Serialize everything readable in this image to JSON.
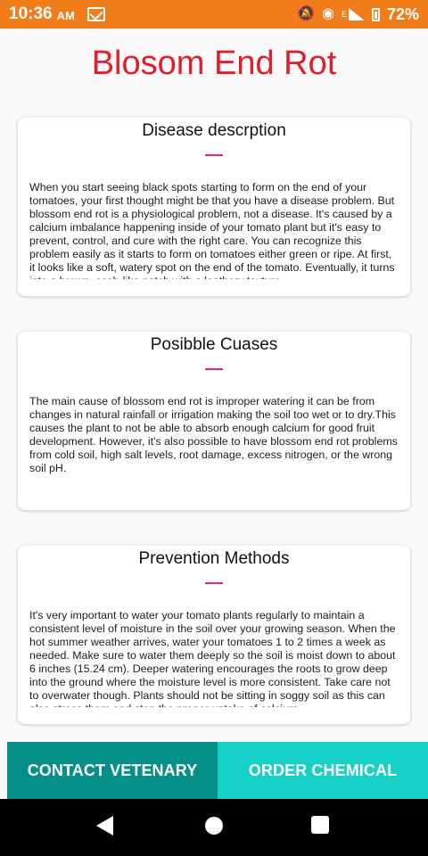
{
  "status_bar": {
    "time": "10:36",
    "ampm": "AM",
    "network_label": "E",
    "battery": "72%",
    "icons": [
      "mail-icon",
      "mute-icon",
      "hotspot-icon",
      "signal-icon",
      "battery-icon"
    ]
  },
  "title": "Blosom End Rot",
  "cards": [
    {
      "title": "Disease descrption",
      "text": "When you start seeing black spots starting to form on the end of your tomatoes, your first thought might be that you have a disease problem. But blossom end rot is a physiological problem, not a disease. It's caused by a calcium imbalance happening inside of your tomato plant but it's easy to prevent, control, and cure with the right care. You can recognize this problem easily as it starts to form on tomatoes either green or ripe. At first, it looks like a soft, watery spot on the end of the tomato. Eventually, it turns into a brown, scab-like patch with a leathery texture."
    },
    {
      "title": "Posibble Cuases",
      "text": "The main cause of blossom end rot is improper watering it can be from changes in natural rainfall or irrigation making the soil too wet or to dry.This causes the plant to not be able to absorb enough calcium for good fruit development. However, it's also possible to have blossom end rot problems from cold soil, high salt levels, root damage, excess nitrogen, or the wrong soil pH."
    },
    {
      "title": "Prevention Methods",
      "text": "It's very important to water your tomato plants regularly to maintain a consistent level of moisture in the soil over your growing season. When the hot summer weather arrives, water your tomatoes 1 to 2 times a week as needed. Make sure to water them deeply so the soil is moist down to about 6 inches (15.24 cm). Deeper watering encourages the roots to grow deep into the ground where the moisture level is more consistent. Take care not to overwater though. Plants should not be sitting in soggy soil as this can also stress them and stop the proper uptake of calcium."
    }
  ],
  "buttons": {
    "contact": "CONTACT VETENARY",
    "order": "ORDER CHEMICAL"
  },
  "nav_bar": {
    "icons": [
      "back-icon",
      "home-icon",
      "recent-apps-icon"
    ]
  },
  "colors": {
    "status_bar": "#f07d1a",
    "title": "#e21d2c",
    "accent_line": "#e91e8c",
    "contact_button": "#048f88",
    "order_button": "#14d0c6"
  }
}
